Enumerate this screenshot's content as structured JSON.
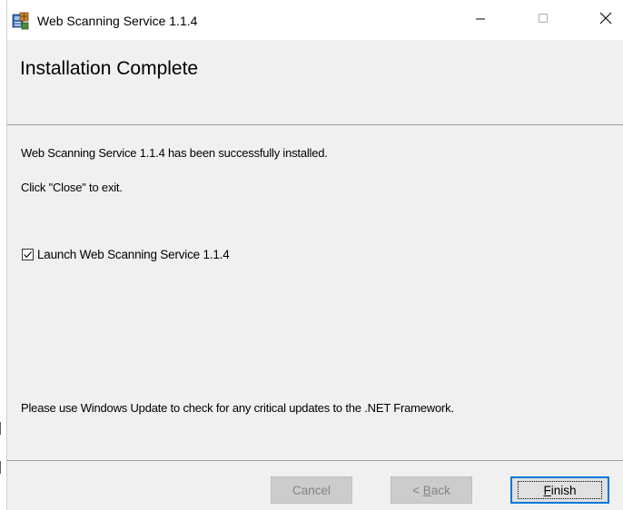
{
  "window": {
    "title": "Web Scanning Service 1.1.4",
    "app_icon": "installer-icon",
    "controls": {
      "minimize_icon": "minimize-icon",
      "maximize_icon": "maximize-icon",
      "close_icon": "close-icon"
    }
  },
  "header": {
    "title": "Installation Complete"
  },
  "content": {
    "installed_message": "Web Scanning Service 1.1.4 has been successfully installed.",
    "exit_message": "Click \"Close\" to exit.",
    "launch_checkbox": {
      "label": "Launch Web Scanning Service 1.1.4",
      "checked": true
    },
    "update_message": "Please use Windows Update to check for any critical updates to the .NET Framework."
  },
  "buttons": {
    "cancel": {
      "label": "Cancel",
      "enabled": false
    },
    "back": {
      "prefix": "< ",
      "mnemonic": "B",
      "rest": "ack",
      "enabled": false
    },
    "finish": {
      "mnemonic": "F",
      "rest": "inish",
      "enabled": true,
      "default": true
    }
  },
  "colors": {
    "dialog_background": "#f0f0f0",
    "titlebar_background": "#ffffff",
    "default_button_border": "#0078d7",
    "disabled_button_text": "#838383"
  }
}
